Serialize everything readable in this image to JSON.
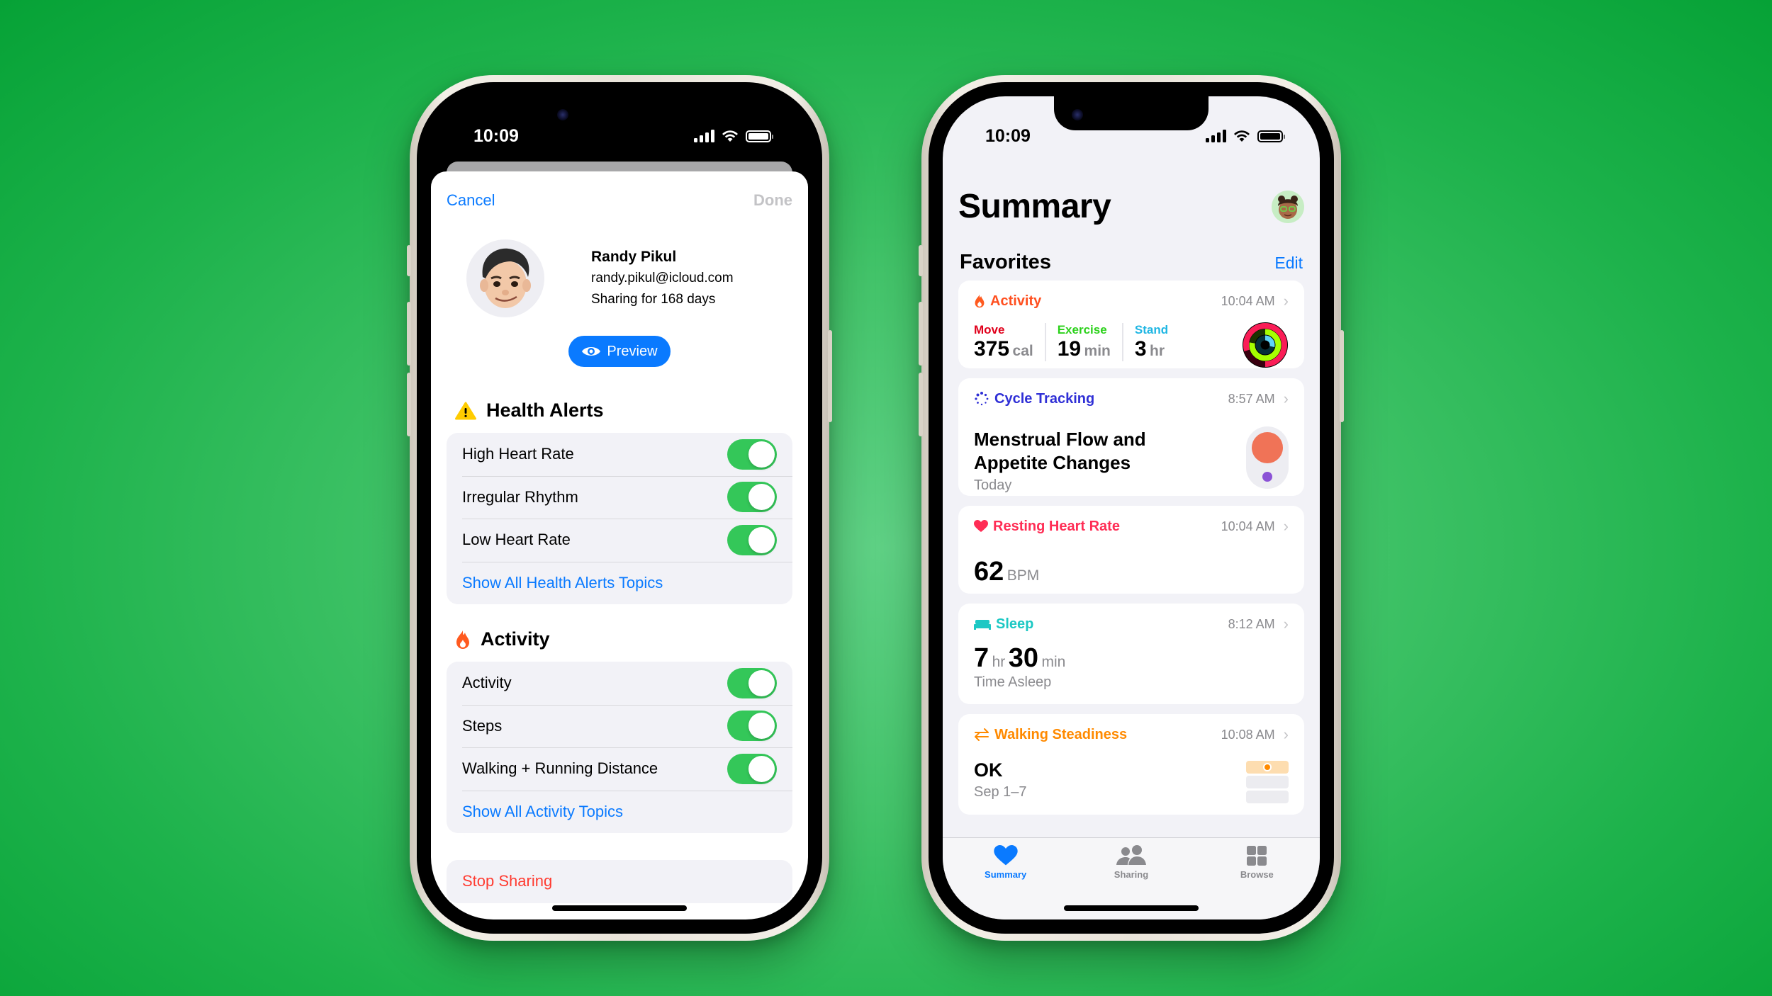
{
  "colors": {
    "accent_blue": "#0a7aff",
    "toggle_green": "#34c759",
    "danger_red": "#ff3b30",
    "activity_orange": "#ff4f1f",
    "move_red": "#e0001b",
    "exercise_green": "#2bd11a",
    "stand_cyan": "#1fb6e3",
    "cycle_blue": "#2f2fd6",
    "heart_red": "#ff2d55",
    "sleep_teal": "#1cc8c4",
    "steadiness_orange": "#ff8a00",
    "background_green": "#34c061"
  },
  "left_phone": {
    "status_bar": {
      "time": "10:09"
    },
    "nav": {
      "cancel_label": "Cancel",
      "done_label": "Done"
    },
    "profile": {
      "name": "Randy Pikul",
      "email": "randy.pikul@icloud.com",
      "sharing_duration": "Sharing for 168 days",
      "avatar_icon": "memoji-avatar"
    },
    "preview_button": {
      "label": "Preview",
      "icon": "eye-icon"
    },
    "sections": [
      {
        "title": "Health Alerts",
        "icon": "warning-triangle-icon",
        "rows": [
          {
            "label": "High Heart Rate",
            "enabled": true
          },
          {
            "label": "Irregular Rhythm",
            "enabled": true
          },
          {
            "label": "Low Heart Rate",
            "enabled": true
          }
        ],
        "show_all_label": "Show All Health Alerts Topics"
      },
      {
        "title": "Activity",
        "icon": "flame-icon",
        "rows": [
          {
            "label": "Activity",
            "enabled": true
          },
          {
            "label": "Steps",
            "enabled": true
          },
          {
            "label": "Walking + Running Distance",
            "enabled": true
          }
        ],
        "show_all_label": "Show All Activity Topics"
      }
    ],
    "stop_sharing_label": "Stop Sharing"
  },
  "right_phone": {
    "status_bar": {
      "time": "10:09"
    },
    "page_title": "Summary",
    "favorites": {
      "title": "Favorites",
      "edit_label": "Edit"
    },
    "cards": {
      "activity": {
        "title": "Activity",
        "time": "10:04 AM",
        "move": {
          "label": "Move",
          "value": "375",
          "unit": "cal"
        },
        "exercise": {
          "label": "Exercise",
          "value": "19",
          "unit": "min"
        },
        "stand": {
          "label": "Stand",
          "value": "3",
          "unit": "hr"
        }
      },
      "cycle": {
        "title": "Cycle Tracking",
        "time": "8:57 AM",
        "headline": "Menstrual Flow and Appetite Changes",
        "subtitle": "Today"
      },
      "heart": {
        "title": "Resting Heart Rate",
        "time": "10:04 AM",
        "value": "62",
        "unit": "BPM"
      },
      "sleep": {
        "title": "Sleep",
        "time": "8:12 AM",
        "hours": "7",
        "hours_unit": "hr",
        "minutes": "30",
        "minutes_unit": "min",
        "subtitle": "Time Asleep"
      },
      "steadiness": {
        "title": "Walking Steadiness",
        "time": "10:08 AM",
        "value": "OK",
        "subtitle": "Sep 1–7"
      }
    },
    "tabs": [
      {
        "label": "Summary",
        "icon": "heart-icon",
        "active": true
      },
      {
        "label": "Sharing",
        "icon": "people-icon",
        "active": false
      },
      {
        "label": "Browse",
        "icon": "grid-icon",
        "active": false
      }
    ]
  }
}
